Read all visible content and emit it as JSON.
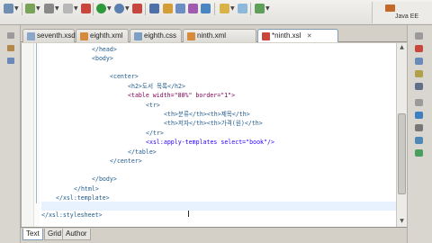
{
  "perspective": {
    "label": "Java EE"
  },
  "editor_tabs": [
    {
      "label": "seventh.xsd",
      "icon": "xsd-file-icon"
    },
    {
      "label": "eighth.xml",
      "icon": "xml-file-icon"
    },
    {
      "label": "eighth.css",
      "icon": "css-file-icon"
    },
    {
      "label": "ninth.xml",
      "icon": "xml-file-icon"
    },
    {
      "label": "*ninth.xsl",
      "icon": "xsl-file-icon",
      "active": true,
      "close": "✕"
    }
  ],
  "code_lines": [
    {
      "text": "</head>"
    },
    {
      "text": "<body>"
    },
    {
      "text": ""
    },
    {
      "text": "<center>"
    },
    {
      "text": "<h2>도서 목록</h2>"
    },
    {
      "text": "<table width=\"80%\" border=\"1\">"
    },
    {
      "text": "<tr>"
    },
    {
      "text": "<th>분류</th><th>제목</th>"
    },
    {
      "text": "<th>저자</th><th>가격(원)</th>"
    },
    {
      "text": "</tr>"
    },
    {
      "text": "<xsl:apply-templates select=\"book\"/>"
    },
    {
      "text": "</table>"
    },
    {
      "text": "</center>"
    },
    {
      "text": ""
    },
    {
      "text": "</body>"
    },
    {
      "text": "</html>"
    },
    {
      "text": "</xsl:template>"
    },
    {
      "text": ""
    },
    {
      "text": "</xsl:stylesheet>"
    }
  ],
  "bottom_tabs": [
    {
      "label": "Text",
      "active": true
    },
    {
      "label": "Grid"
    },
    {
      "label": "Author"
    }
  ],
  "colors": {
    "tag": "#1f5a8c",
    "attr": "#7f0055",
    "value": "#2a00ff",
    "active_tab_border": "#7f9db9",
    "current_line": "#e8f2fe"
  }
}
